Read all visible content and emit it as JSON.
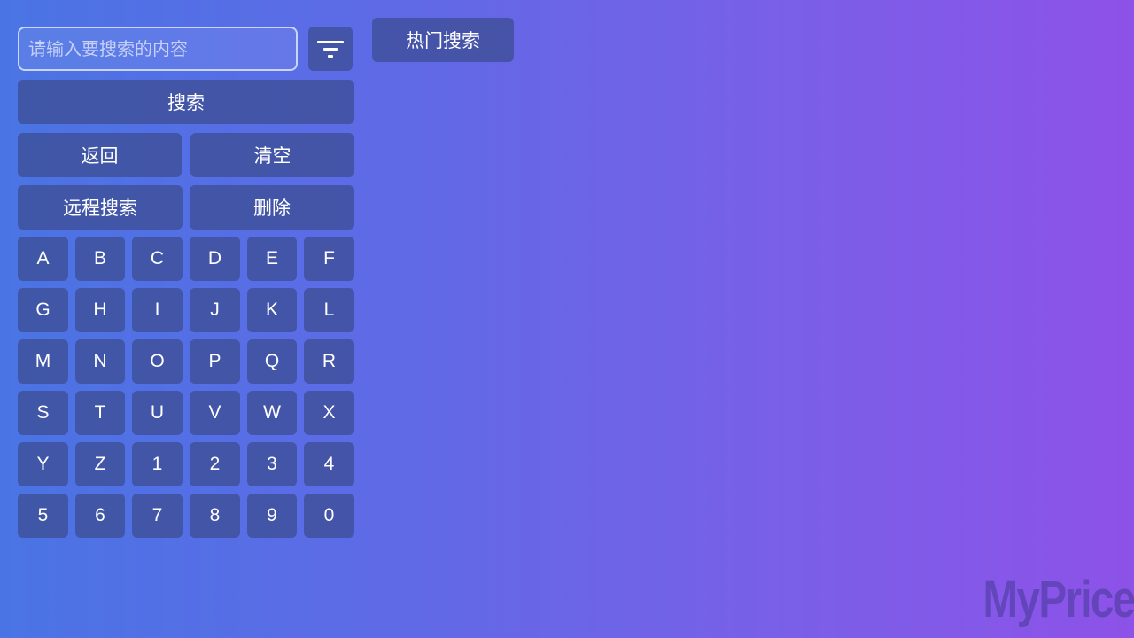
{
  "search": {
    "placeholder": "请输入要搜索的内容",
    "value": ""
  },
  "filter": {
    "icon": "filter-icon"
  },
  "actions": {
    "search_label": "搜索",
    "back_label": "返回",
    "clear_label": "清空",
    "remote_search_label": "远程搜索",
    "delete_label": "删除"
  },
  "hot_search": {
    "label": "热门搜索"
  },
  "keyboard": {
    "keys": [
      "A",
      "B",
      "C",
      "D",
      "E",
      "F",
      "G",
      "H",
      "I",
      "J",
      "K",
      "L",
      "M",
      "N",
      "O",
      "P",
      "Q",
      "R",
      "S",
      "T",
      "U",
      "V",
      "W",
      "X",
      "Y",
      "Z",
      "1",
      "2",
      "3",
      "4",
      "5",
      "6",
      "7",
      "8",
      "9",
      "0"
    ]
  },
  "watermark": {
    "text": "MyPrice"
  },
  "colors": {
    "background_start": "#4a74e4",
    "background_end": "#8d52e8",
    "button_bg": "#3e4e96",
    "input_border": "#c9d4ff"
  }
}
